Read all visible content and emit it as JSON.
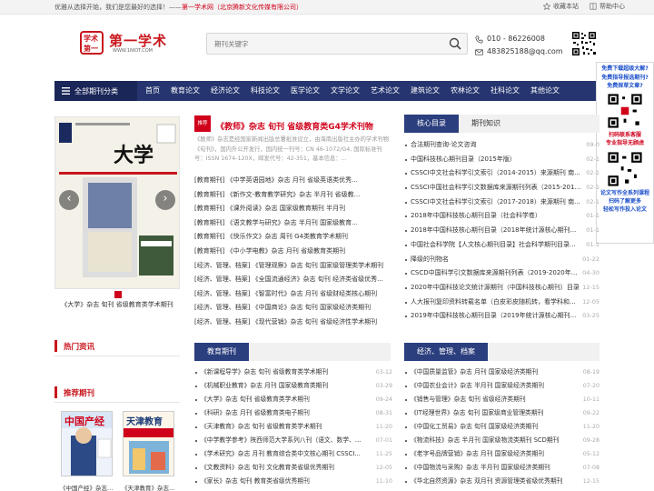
{
  "topbar": {
    "welcome_prefix": "优雅从选择开始，我们是您最好的选择！——",
    "welcome_link": "第一学术网（北京腾新文化传媒有限公司）",
    "bookmark": "收藏本站",
    "help": "帮助中心"
  },
  "logo": {
    "name": "第一学术",
    "seal_top": "学术",
    "seal_bottom": "第一",
    "url": "WWW.1NIOT.COM"
  },
  "search": {
    "placeholder": "期刊关键字"
  },
  "contact": {
    "phone": "010 - 86226008",
    "email": "483825188@qq.com"
  },
  "nav": {
    "all_categories": "全部期刊分类",
    "items": [
      "首页",
      "教育论文",
      "经济论文",
      "科技论文",
      "医学论文",
      "文学论文",
      "艺术论文",
      "建筑论文",
      "农林论文",
      "社科论文",
      "其他论文"
    ]
  },
  "side_float": {
    "lines_blue": [
      "免费下载超级大解?",
      "免费指导报选期刊?",
      "免费探草文章?"
    ],
    "scan1": "扫码联系客服",
    "scan2": "专业指导无顾虑",
    "promo1": "论文写作全系列课程",
    "promo2": "扫码了解更多",
    "promo3": "轻松写作投入论文"
  },
  "slider": {
    "caption": "《大学》杂志 旬刊 省级教育类学术期刊",
    "cover_title": "大学",
    "prev": "‹",
    "next": "›"
  },
  "headline": {
    "tag": "推荐",
    "title": "《教师》杂志 旬刊 省级教育类G4学术刊物",
    "description": "《教师》杂志是经国家新闻出版总署批准设立，由海南出版社主办的学术刊物《旬刊》，国内外公开发行，国内统一刊号：CN 46-1072/G4, 国际标准刊号：ISSN 1674-120X，邮发代号：42-351，基本信息：..."
  },
  "mid_list": [
    "[教育期刊] 《中学英语园地》杂志 月刊 省级英语类优秀...",
    "[教育期刊] 《新作文-教育教学研究》杂志 半月刊 省级教...",
    "[教育期刊] 《课外阅读》杂志 国家级教育期刊 半月刊",
    "[教育期刊] 《语文教学与研究》杂志 半月刊 国家级教育...",
    "[教育期刊] 《快乐作文》杂志 周刊 G4类教育学术期刊",
    "[教育期刊] 《中小学电教》杂志 月刊 省级教育类期刊",
    "[经济、管理、档案] 《管理观察》杂志 旬刊 国家级管理类学术期刊",
    "[经济、管理、档案] 《全国流通经济》杂志 旬刊 经济类省级优秀...",
    "[经济、管理、档案] 《智富时代》杂志 月刊 省级财经类核心期刊",
    "[经济、管理、档案] 《中国商论》杂志 旬刊 国家级经济类期刊",
    "[经济、管理、档案] 《现代营销》杂志 旬刊 省级经济性学术期刊"
  ],
  "right_tabs": [
    "核心目录",
    "期刊知识"
  ],
  "right_list": [
    {
      "title": "合法期刊查询-论文咨询",
      "date": "09-0"
    },
    {
      "title": "中国科技核心期刊目录（2015年版）",
      "date": "02-1"
    },
    {
      "title": "CSSCI中文社会科学引文索引（2014-2015）来源期刊 南...",
      "date": "02-1"
    },
    {
      "title": "CSSCI中国社会科学引文数据库来源期刊列表（2015-2016年...",
      "date": "02-1"
    },
    {
      "title": "CSSCI中文社会科学引文索引（2017-2018）来源期刊 南...",
      "date": "02-1"
    },
    {
      "title": "2018年中国科技核心期刊目录（社会科学卷）",
      "date": "01-1"
    },
    {
      "title": "2018年中国科技核心期刊目录（2018年统计源核心期刊...",
      "date": "01-1"
    },
    {
      "title": "中国社会科学院【人文核心期刊目录】社会科学期刊目录...",
      "date": "01-1"
    },
    {
      "title": "降级的刊物名",
      "date": "01-22"
    },
    {
      "title": "CSCD中国科学引文数据库来源期刊列表（2019-2020年...",
      "date": "04-30"
    },
    {
      "title": "2020年中国科技论文统计源期刊（中国科技核心期刊）目录",
      "date": "12-15"
    },
    {
      "title": "人大报刊复印资料转载名单（白皮彩皮随机转，看学科和...",
      "date": "12-05"
    },
    {
      "title": "2019年中国科技核心期刊目录（2019年统计源核心期刊...",
      "date": "03-25"
    }
  ],
  "hot_info_title": "热门资讯",
  "recommend_title": "推荐期刊",
  "recommend_mags": [
    {
      "caption": "《中国产经》杂志 旬",
      "cover": "中国产经"
    },
    {
      "caption": "《天津教育》杂志 旬",
      "cover": "天津教育"
    }
  ],
  "edu_section": {
    "label": "教育期刊",
    "items": [
      {
        "title": "《新课程导学》杂志 旬刊 省级教育类学术期刊",
        "date": "03-12"
      },
      {
        "title": "《机械职业教育》杂志 月刊 国家级教育类期刊",
        "date": "03-29"
      },
      {
        "title": "《大学》杂志 旬刊 省级教育类学术期刊",
        "date": "09-24"
      },
      {
        "title": "《科研》杂志 月刊 省级教育类电子期刊",
        "date": "08-31"
      },
      {
        "title": "《天津教育》杂志 旬刊 省级教育类学术期刊",
        "date": "11-20"
      },
      {
        "title": "《中学教学参考》陕西师范大学系列八刊（语文、数学、...",
        "date": "07-01"
      },
      {
        "title": "《学术研究》杂志 月刊 教育综合类中文核心期刊 CSSCI...",
        "date": "11-25"
      },
      {
        "title": "《文教资料》杂志 旬刊 文化教育类省级优秀期刊",
        "date": "12-05"
      },
      {
        "title": "《家长》杂志 旬刊 教育类省级优秀期刊",
        "date": "11-10"
      }
    ]
  },
  "econ_section": {
    "label": "经济、管理、档案",
    "items": [
      {
        "title": "《中国质量监管》杂志 月刊 国家级经济类期刊",
        "date": "08-19"
      },
      {
        "title": "《中国农业会计》杂志 半月刊 国家级经济类期刊",
        "date": "07-20"
      },
      {
        "title": "《销售与管理》杂志 旬刊 省级经济类期刊",
        "date": "10-11"
      },
      {
        "title": "《IT经理世界》杂志 旬刊 国家级商业管理类期刊",
        "date": "09-22"
      },
      {
        "title": "《中国化工贸易》杂志 旬刊 国家级经济类期刊",
        "date": "11-20"
      },
      {
        "title": "《物流科技》杂志 半月刊 国家级物流类期刊 SCD期刊",
        "date": "09-28"
      },
      {
        "title": "《老字号品牌营销》杂志 月刊 国家级经济类期刊",
        "date": "05-12"
      },
      {
        "title": "《中国物流与采购》杂志 半月刊 国家级经济类期刊",
        "date": "07-08"
      },
      {
        "title": "《华北自然资源》杂志 双月刊 资源管理类省级优秀期刊",
        "date": "12-15"
      }
    ]
  }
}
